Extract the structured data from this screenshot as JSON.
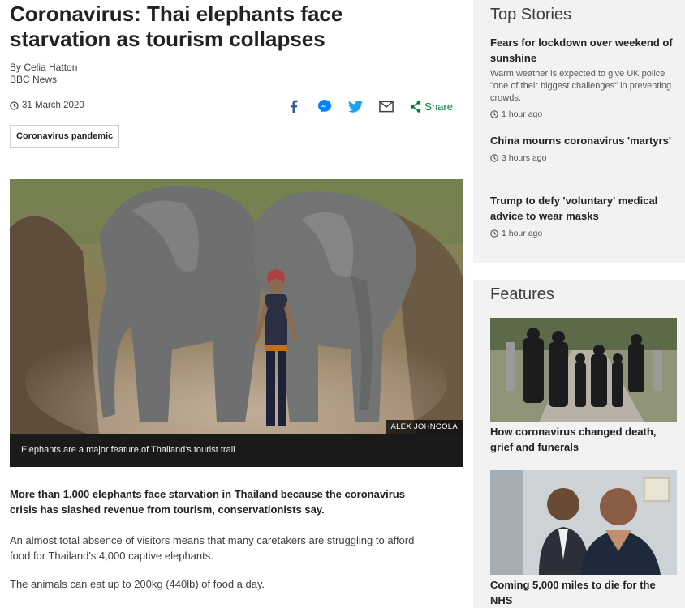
{
  "article": {
    "headline": "Coronavirus: Thai elephants face starvation as tourism collapses",
    "author": "By Celia Hatton",
    "outlet": "BBC News",
    "date": "31 March 2020",
    "share_label": "Share",
    "topic_tag": "Coronavirus pandemic",
    "image_credit": "ALEX JOHNCOLA",
    "image_caption": "Elephants are a major feature of Thailand's tourist trail",
    "lead": "More than 1,000 elephants face starvation in Thailand because the coronavirus crisis has slashed revenue from tourism, conservationists say.",
    "paragraphs": [
      "An almost total absence of visitors means that many caretakers are struggling to afford food for Thailand's 4,000 captive elephants.",
      "The animals can eat up to 200kg (440lb) of food a day."
    ]
  },
  "share_icons": [
    "facebook-icon",
    "messenger-icon",
    "twitter-icon",
    "email-icon",
    "share-icon"
  ],
  "colors": {
    "share_green": "#007d3a",
    "facebook": "#3b5998",
    "messenger": "#0084ff",
    "twitter": "#1da1f2",
    "sidebar_bg": "#f2f2f2"
  },
  "sidebar": {
    "top_stories": {
      "title": "Top Stories",
      "items": [
        {
          "title": "Fears for lockdown over weekend of sunshine",
          "summary": "Warm weather is expected to give UK police \"one of their biggest challenges\" in preventing crowds.",
          "time": "1 hour ago"
        },
        {
          "title": "China mourns coronavirus 'martyrs'",
          "time": "3 hours ago"
        },
        {
          "title": "Trump to defy 'voluntary' medical advice to wear masks",
          "time": "1 hour ago"
        }
      ]
    },
    "features": {
      "title": "Features",
      "items": [
        {
          "title": "How coronavirus changed death, grief and funerals"
        },
        {
          "title": "Coming 5,000 miles to die for the NHS"
        }
      ]
    }
  }
}
